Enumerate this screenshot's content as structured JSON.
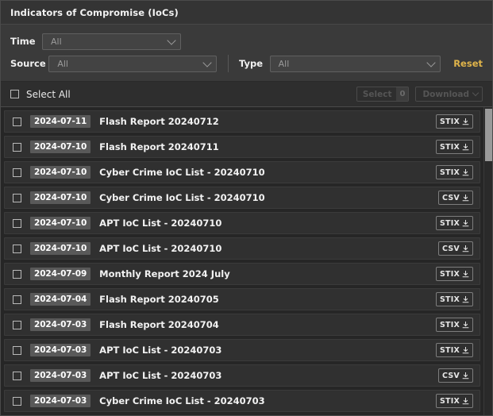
{
  "window": {
    "title": "Indicators of Compromise (IoCs)"
  },
  "filters": {
    "time": {
      "label": "Time",
      "value": "All",
      "icon": "chevron-down-icon"
    },
    "source": {
      "label": "Source",
      "value": "All",
      "icon": "chevron-down-icon"
    },
    "type": {
      "label": "Type",
      "value": "All",
      "icon": "chevron-down-icon"
    },
    "reset_label": "Reset"
  },
  "actionbar": {
    "select_all_label": "Select All",
    "select_button_label": "Select",
    "selected_count": "0",
    "download_button_label": "Download",
    "download_chevron_icon": "chevron-down-icon"
  },
  "colors": {
    "accent": "#e0b44a",
    "window_bg": "#2b2b2b",
    "titlebar_bg": "#343434",
    "filter_bg": "#3a3a3a",
    "list_bg": "#262626",
    "row_bg": "#303030",
    "date_badge_bg": "#595959",
    "scrollbar_thumb": "#9a9a9a"
  },
  "list": {
    "download_icon": "download-icon",
    "checkbox_icon": "checkbox-unchecked-icon",
    "rows": [
      {
        "date": "2024-07-11",
        "title": "Flash Report 20240712",
        "format": "STIX"
      },
      {
        "date": "2024-07-10",
        "title": "Flash Report 20240711",
        "format": "STIX"
      },
      {
        "date": "2024-07-10",
        "title": "Cyber Crime IoC List - 20240710",
        "format": "STIX"
      },
      {
        "date": "2024-07-10",
        "title": "Cyber Crime IoC List - 20240710",
        "format": "CSV"
      },
      {
        "date": "2024-07-10",
        "title": "APT IoC List - 20240710",
        "format": "STIX"
      },
      {
        "date": "2024-07-10",
        "title": "APT IoC List - 20240710",
        "format": "CSV"
      },
      {
        "date": "2024-07-09",
        "title": "Monthly Report 2024 July",
        "format": "STIX"
      },
      {
        "date": "2024-07-04",
        "title": "Flash Report 20240705",
        "format": "STIX"
      },
      {
        "date": "2024-07-03",
        "title": "Flash Report 20240704",
        "format": "STIX"
      },
      {
        "date": "2024-07-03",
        "title": "APT IoC List - 20240703",
        "format": "STIX"
      },
      {
        "date": "2024-07-03",
        "title": "APT IoC List - 20240703",
        "format": "CSV"
      },
      {
        "date": "2024-07-03",
        "title": "Cyber Crime IoC List - 20240703",
        "format": "STIX"
      }
    ]
  },
  "scrollbar": {
    "thumb_top_pct": 0.5,
    "thumb_height_pct": 17
  }
}
